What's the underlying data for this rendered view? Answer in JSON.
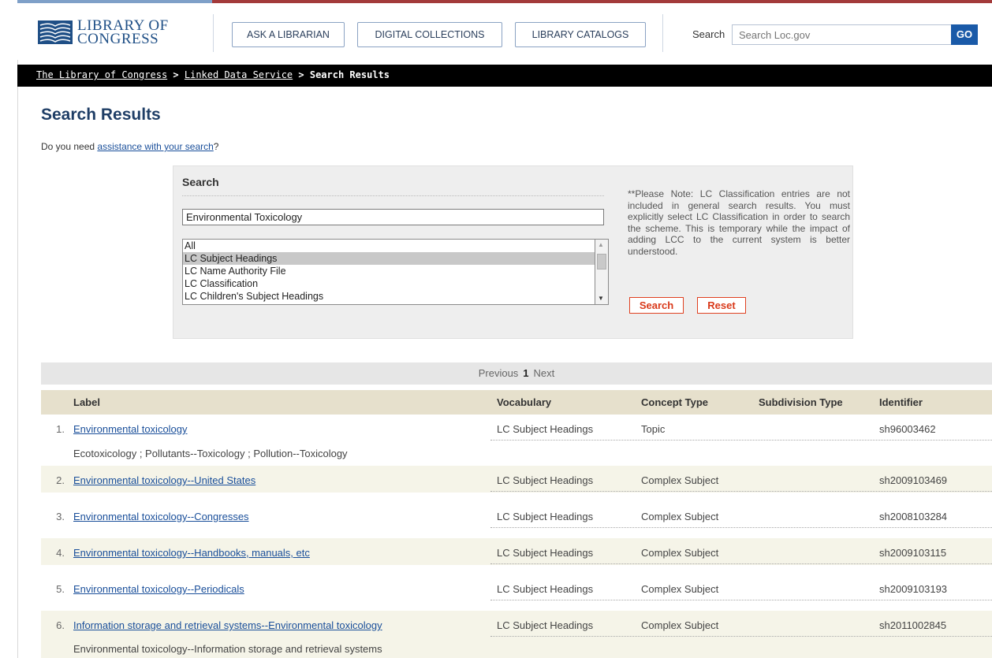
{
  "header": {
    "logo_line1": "LIBRARY OF",
    "logo_line2": "CONGRESS",
    "nav_buttons": [
      "ASK A LIBRARIAN",
      "DIGITAL COLLECTIONS",
      "LIBRARY CATALOGS"
    ],
    "search_label": "Search",
    "search_placeholder": "Search Loc.gov",
    "go_label": "GO"
  },
  "breadcrumb": {
    "item1": "The Library of Congress",
    "sep": ">",
    "item2": "Linked Data Service",
    "current": "Search Results"
  },
  "page": {
    "title": "Search Results",
    "assist_prefix": "Do you need ",
    "assist_link": "assistance with your search",
    "assist_suffix": "?"
  },
  "search_panel": {
    "title": "Search",
    "term_value": "Environmental Toxicology",
    "vocab_options": [
      "All",
      "LC Subject Headings",
      "LC Name Authority File",
      "LC Classification",
      "LC Children's Subject Headings"
    ],
    "selected_option": "LC Subject Headings",
    "note": "**Please Note: LC Classification entries are not included in general search results. You must explicitly select LC Classification in order to search the scheme. This is temporary while the impact of adding LCC to the current system is better understood.",
    "search_button": "Search",
    "reset_button": "Reset"
  },
  "pager": {
    "previous": "Previous",
    "current": "1",
    "next": "Next"
  },
  "results": {
    "columns": [
      "Label",
      "Vocabulary",
      "Concept Type",
      "Subdivision Type",
      "Identifier"
    ],
    "rows": [
      {
        "num": "1.",
        "label": "Environmental toxicology",
        "vocabulary": "LC Subject Headings",
        "concept": "Topic",
        "subdivision": "",
        "identifier": "sh96003462",
        "alt": "Ecotoxicology ; Pollutants--Toxicology ; Pollution--Toxicology"
      },
      {
        "num": "2.",
        "label": "Environmental toxicology--United States",
        "vocabulary": "LC Subject Headings",
        "concept": "Complex Subject",
        "subdivision": "",
        "identifier": "sh2009103469",
        "alt": ""
      },
      {
        "num": "3.",
        "label": "Environmental toxicology--Congresses",
        "vocabulary": "LC Subject Headings",
        "concept": "Complex Subject",
        "subdivision": "",
        "identifier": "sh2008103284",
        "alt": ""
      },
      {
        "num": "4.",
        "label": "Environmental toxicology--Handbooks, manuals, etc",
        "vocabulary": "LC Subject Headings",
        "concept": "Complex Subject",
        "subdivision": "",
        "identifier": "sh2009103115",
        "alt": ""
      },
      {
        "num": "5.",
        "label": "Environmental toxicology--Periodicals",
        "vocabulary": "LC Subject Headings",
        "concept": "Complex Subject",
        "subdivision": "",
        "identifier": "sh2009103193",
        "alt": ""
      },
      {
        "num": "6.",
        "label": "Information storage and retrieval systems--Environmental toxicology",
        "vocabulary": "LC Subject Headings",
        "concept": "Complex Subject",
        "subdivision": "",
        "identifier": "sh2011002845",
        "alt": "Environmental toxicology--Information storage and retrieval systems"
      }
    ]
  }
}
